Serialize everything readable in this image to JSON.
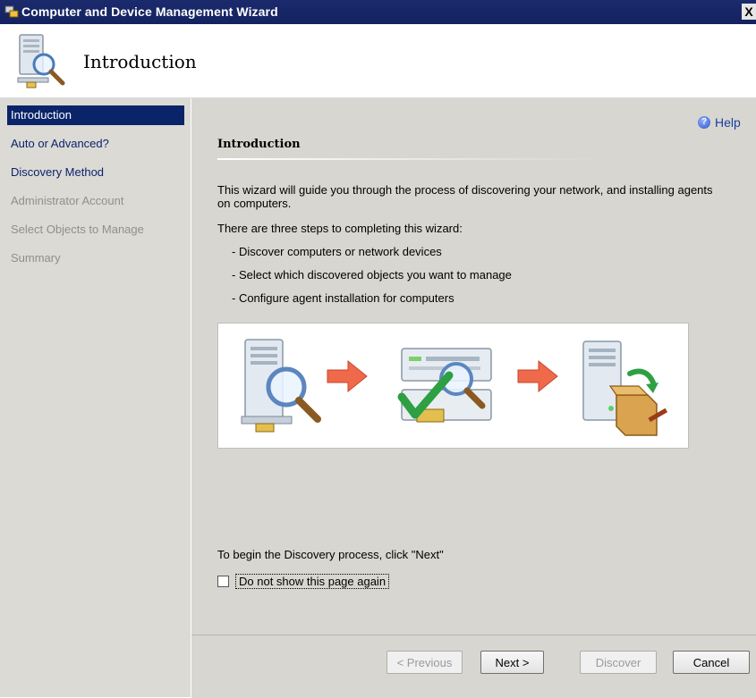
{
  "window": {
    "title": "Computer and Device Management Wizard",
    "close_label": "X"
  },
  "header": {
    "title": "Introduction"
  },
  "sidebar": {
    "items": [
      {
        "label": "Introduction",
        "state": "active"
      },
      {
        "label": "Auto or Advanced?",
        "state": "enabled"
      },
      {
        "label": "Discovery Method",
        "state": "enabled"
      },
      {
        "label": "Administrator Account",
        "state": "disabled"
      },
      {
        "label": "Select Objects to Manage",
        "state": "disabled"
      },
      {
        "label": "Summary",
        "state": "disabled"
      }
    ]
  },
  "main": {
    "help_label": "Help",
    "section_title": "Introduction",
    "intro_text": "This wizard will guide you through the process of discovering your network, and installing agents on computers.",
    "steps_intro": "There are three steps to completing this wizard:",
    "steps": [
      "- Discover computers or network devices",
      "- Select which discovered objects you want to manage",
      "- Configure agent installation for computers"
    ],
    "begin_text": "To begin the Discovery process, click \"Next\"",
    "checkbox_label": "Do not show this page again"
  },
  "footer": {
    "previous_label": "< Previous",
    "next_label": "Next >",
    "discover_label": "Discover",
    "cancel_label": "Cancel"
  },
  "colors": {
    "titlebar": "#1a2a6c",
    "active_nav": "#0a246a",
    "link_nav": "#0a246a",
    "disabled_nav": "#8f8f8f"
  }
}
